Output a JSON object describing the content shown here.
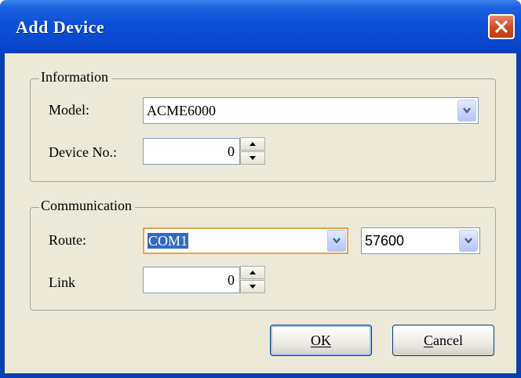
{
  "window": {
    "title": "Add Device",
    "close_icon": "close-icon"
  },
  "information": {
    "legend": "Information",
    "model_label": "Model:",
    "model_value": "ACME6000",
    "device_no_label": "Device No.:",
    "device_no_value": "0"
  },
  "communication": {
    "legend": "Communication",
    "route_label": "Route:",
    "route_value": "COM1",
    "baud_value": "57600",
    "link_label": "Link",
    "link_value": "0"
  },
  "buttons": {
    "ok": "OK",
    "cancel": "Cancel"
  },
  "colors": {
    "title_bar": "#0a48cf",
    "close_button": "#d0491f",
    "focus_border": "#f0a24a",
    "selection": "#316ac5",
    "dialog_bg": "#ece9d8"
  }
}
